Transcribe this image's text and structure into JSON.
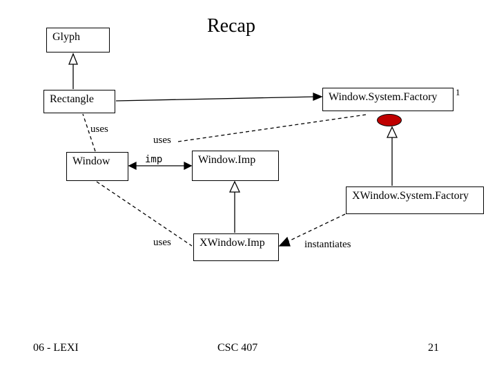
{
  "title": "Recap",
  "boxes": {
    "glyph": "Glyph",
    "rectangle": "Rectangle",
    "window": "Window",
    "windowImp": "Window.Imp",
    "xWindowImp": "XWindow.Imp",
    "wsFactory": "Window.System.Factory",
    "xwsFactory": "XWindow.System.Factory"
  },
  "labels": {
    "uses1": "uses",
    "uses2": "uses",
    "uses3": "uses",
    "imp": "imp",
    "one": "1",
    "instantiates": "instantiates"
  },
  "footer": {
    "left": "06 - LEXI",
    "center": "CSC 407",
    "right": "21"
  }
}
